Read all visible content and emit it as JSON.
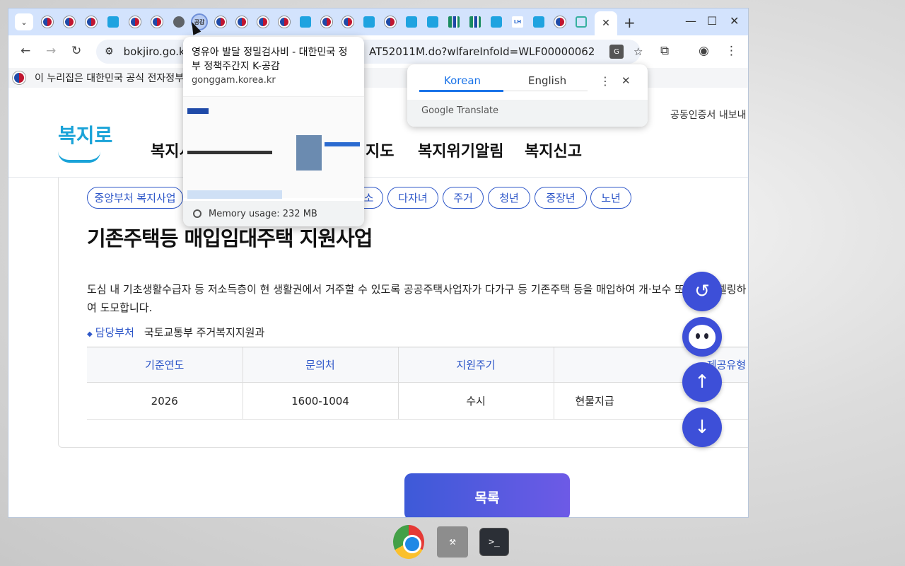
{
  "browser": {
    "address": "bokjiro.go.kr",
    "address_tail": "AT52011M.do?wlfareInfoId=WLF00000062",
    "new_tab": "+",
    "active_tab_close": "✕"
  },
  "gov_banner": "이 누리집은 대한민국 공식 전자정부",
  "hover_card": {
    "title": "영유아 발달 정밀검사비 - 대한민국 정부 정책주간지 K-공감",
    "url": "gonggam.korea.kr",
    "memory": "Memory usage: 232 MB",
    "tab_favicon_text": "공감"
  },
  "translate": {
    "lang_from": "Korean",
    "lang_to": "English",
    "footer": "Google Translate"
  },
  "site": {
    "logo": "복지로",
    "menu": [
      "복지서",
      "지도",
      "복지위기알림",
      "복지신고"
    ],
    "cert_button": "공동인증서 내보내",
    "chips": [
      "중앙부처 복지사업",
      "소",
      "다자녀",
      "주거",
      "청년",
      "중장년",
      "노년"
    ],
    "title": "기존주택등 매입임대주택 지원사업",
    "description": "도심 내 기초생활수급자 등 저소득층이 현 생활권에서 거주할 수 있도록 공공주택사업자가 다가구 등 기존주택 등을 매입하여 개·보수 또는 리모델링하여 도모합니다.",
    "dept_label": "담당부처",
    "dept_value": "국토교통부 주거복지지원과",
    "table": {
      "headers": [
        "기준연도",
        "문의처",
        "지원주기",
        "제공유형"
      ],
      "row": [
        "2026",
        "1600-1004",
        "수시",
        "현물지급"
      ]
    },
    "list_button": "목록"
  },
  "colors": {
    "accent": "#2d56c8",
    "tabstrip": "#d3e3fd",
    "float_button": "#3d4fd8"
  }
}
